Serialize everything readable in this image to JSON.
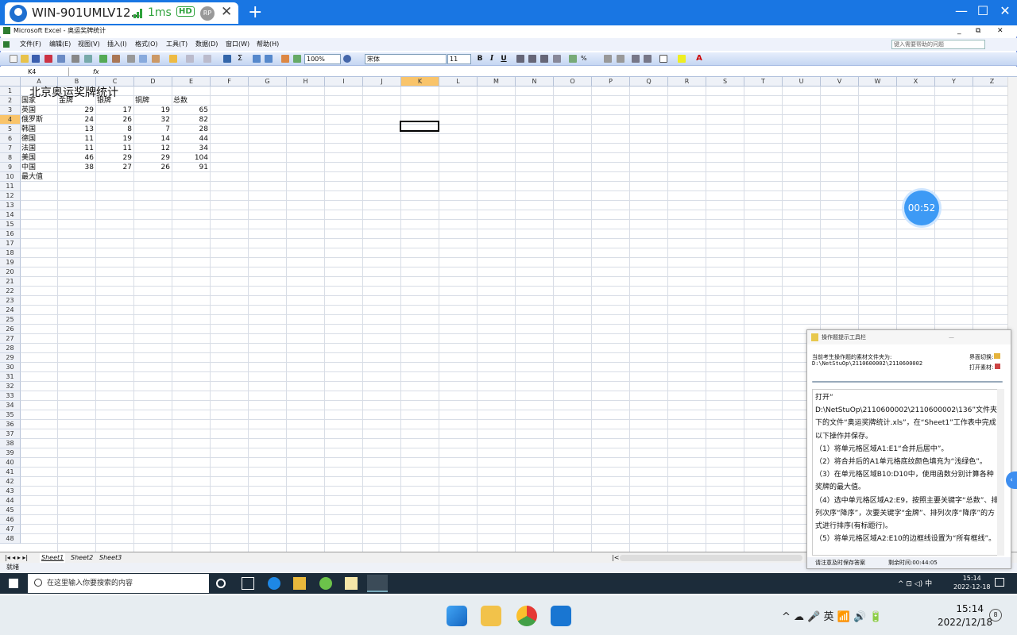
{
  "browser": {
    "tab_title": "WIN-901UMLV12...",
    "latency": "1ms",
    "hd": "HD",
    "rp": "RP",
    "close": "✕",
    "new_tab": "+"
  },
  "excel": {
    "title": "Microsoft Excel - 奥运奖牌统计",
    "menu": [
      "文件(F)",
      "编辑(E)",
      "视图(V)",
      "插入(I)",
      "格式(O)",
      "工具(T)",
      "数据(D)",
      "窗口(W)",
      "帮助(H)"
    ],
    "help_placeholder": "键入需要帮助的问题",
    "zoom": "100%",
    "font": "宋体",
    "font_size": "11",
    "name_box": "K4",
    "fx": "fx",
    "columns": [
      "A",
      "B",
      "C",
      "D",
      "E",
      "F",
      "G",
      "H",
      "I",
      "J",
      "K",
      "L",
      "M",
      "N",
      "O",
      "P",
      "Q",
      "R",
      "S",
      "T",
      "U",
      "V",
      "W",
      "X",
      "Y",
      "Z"
    ],
    "rows": [
      "1",
      "2",
      "3",
      "4",
      "5",
      "6",
      "7",
      "8",
      "9",
      "10",
      "11",
      "12",
      "13",
      "14",
      "15",
      "16",
      "17",
      "18",
      "19",
      "20",
      "21",
      "22",
      "23",
      "24",
      "25",
      "26",
      "27",
      "28",
      "29",
      "30",
      "31",
      "32",
      "33",
      "34",
      "35",
      "36",
      "37",
      "38",
      "39",
      "40",
      "41",
      "42",
      "43",
      "44",
      "45",
      "46",
      "47",
      "48"
    ],
    "sheet_title": "北京奥运奖牌统计",
    "headers": [
      "国家",
      "金牌",
      "银牌",
      "铜牌",
      "总数"
    ],
    "data": [
      [
        "英国",
        "29",
        "17",
        "19",
        "65"
      ],
      [
        "俄罗斯",
        "24",
        "26",
        "32",
        "82"
      ],
      [
        "韩国",
        "13",
        "8",
        "7",
        "28"
      ],
      [
        "德国",
        "11",
        "19",
        "14",
        "44"
      ],
      [
        "法国",
        "11",
        "11",
        "12",
        "34"
      ],
      [
        "美国",
        "46",
        "29",
        "29",
        "104"
      ],
      [
        "中国",
        "38",
        "27",
        "26",
        "91"
      ]
    ],
    "max_label": "最大值",
    "sheets": [
      "Sheet1",
      "Sheet2",
      "Sheet3"
    ],
    "status": "就绪",
    "font_buttons": [
      "B",
      "I",
      "U"
    ]
  },
  "timer": "00:52",
  "tip_panel": {
    "title": "操作题提示工具栏",
    "folder_label": "当前考生操作题的素材文件夹为:",
    "folder_path": "D:\\NetStuOp\\2110600002\\2110600002",
    "switch_label": "界面切换:",
    "open_label": "打开素材:",
    "instructions": [
      "打开“ D:\\NetStuOp\\2110600002\\2110600002\\136”文件夹下的文件“奥运奖牌统计.xls”，在“Sheet1”工作表中完成以下操作并保存。",
      "（1）将单元格区域A1:E1“合并后居中”。",
      "（2）将合并后的A1单元格底纹颜色填充为“浅绿色”。",
      "（3）在单元格区域B10:D10中，使用函数分别计算各种奖牌的最大值。",
      "（4）选中单元格区域A2:E9，按照主要关键字“总数”、排列次序“降序”，次要关键字“金牌”、排列次序“降序”的方式进行排序(有标题行)。",
      "（5）将单元格区域A2:E10的边框线设置为“所有框线”。"
    ],
    "footer_left": "请注意及时保存答案",
    "footer_right": "剩余时间:00:44:05"
  },
  "inner_taskbar": {
    "search_placeholder": "在这里输入你要搜索的内容",
    "time": "15:14",
    "date": "2022-12-18",
    "ime": "中"
  },
  "host_taskbar": {
    "time": "15:14",
    "date": "2022/12/18",
    "ime": "英",
    "notifications": "8"
  }
}
